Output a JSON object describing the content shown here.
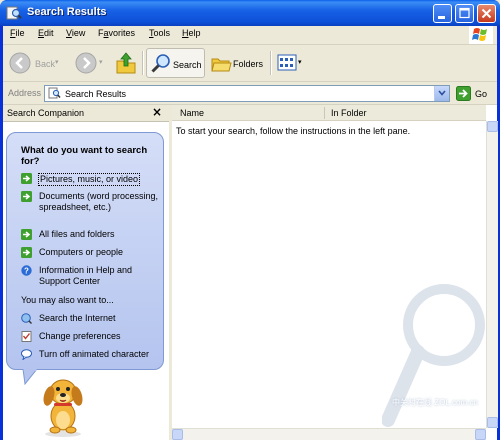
{
  "window": {
    "title": "Search Results"
  },
  "menu": [
    {
      "label": "File",
      "accel": "F",
      "rest": "ile"
    },
    {
      "label": "Edit",
      "accel": "E",
      "rest": "dit"
    },
    {
      "label": "View",
      "accel": "V",
      "rest": "iew"
    },
    {
      "label": "Favorites",
      "accel": "",
      "pre": "F",
      "mid": "a",
      "post": "vorites"
    },
    {
      "label": "Tools",
      "accel": "T",
      "rest": "ools"
    },
    {
      "label": "Help",
      "accel": "H",
      "rest": "elp"
    }
  ],
  "toolbar": {
    "back_label": "Back",
    "search_label": "Search",
    "folders_label": "Folders"
  },
  "address": {
    "label": "Address",
    "value": "Search Results",
    "go_label": "Go"
  },
  "search_companion": {
    "title": "Search Companion",
    "close_glyph": "×",
    "question": "What do you want to search for?",
    "options": [
      {
        "label": "Pictures, music, or video",
        "icon": "green-arrow-icon"
      },
      {
        "label": "Documents (word processing, spreadsheet, etc.)",
        "icon": "green-arrow-icon"
      },
      {
        "label": "All files and folders",
        "icon": "green-arrow-icon"
      },
      {
        "label": "Computers or people",
        "icon": "green-arrow-icon"
      },
      {
        "label": "Information in Help and Support Center",
        "icon": "help-icon"
      }
    ],
    "also_heading": "You may also want to...",
    "also_options": [
      {
        "label": "Search the Internet",
        "icon": "globe-search-icon"
      },
      {
        "label": "Change preferences",
        "icon": "checklist-icon"
      },
      {
        "label": "Turn off animated character",
        "icon": "speech-bubble-icon"
      }
    ]
  },
  "results": {
    "columns": [
      "Name",
      "In Folder"
    ],
    "hint": "To start your search, follow the instructions in the left pane."
  },
  "watermark": {
    "text": "中关村在线 ZOL.com.cn"
  },
  "colors": {
    "title_bar": "#0d4fd8",
    "panel_bubble": "#c5d2f3",
    "go_green": "#3fa02f"
  }
}
